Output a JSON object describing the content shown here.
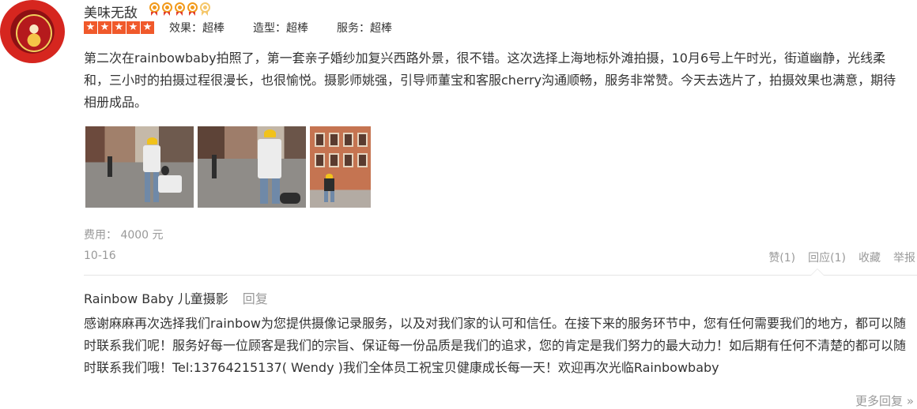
{
  "user": {
    "name": "美味无敌",
    "medal_count": 5
  },
  "rating": {
    "stars": 5,
    "scores": [
      "效果：超棒",
      "造型：超棒",
      "服务：超棒"
    ]
  },
  "review": {
    "text": "第二次在rainbowbaby拍照了，第一套亲子婚纱加复兴西路外景，很不错。这次选择上海地标外滩拍摄，10月6号上午时光，街道幽静，光线柔和，三小时的拍摄过程很漫长，也很愉悦。摄影师姚强，引导师董宝和客服cherry沟通顺畅，服务非常赞。今天去选片了，拍摄效果也满意，期待相册成品。",
    "fee": "费用： 4000 元",
    "date": "10-16"
  },
  "actions": {
    "like": "赞(1)",
    "reply": "回应(1)",
    "favorite": "收藏",
    "report": "举报"
  },
  "reply": {
    "author": "Rainbow Baby 儿童摄影",
    "label": "回复",
    "text": "感谢麻麻再次选择我们rainbow为您提供摄像记录服务，以及对我们家的认可和信任。在接下来的服务环节中，您有任何需要我们的地方，都可以随时联系我们呢！服务好每一位顾客是我们的宗旨、保证每一份品质是我们的追求，您的肯定是我们努力的最大动力！如后期有任何不清楚的都可以随时联系我们哦！Tel:13764215137( Wendy )我们全体员工祝宝贝健康成长每一天！欢迎再次光临Rainbowbaby"
  },
  "more_replies": "更多回复 »"
}
